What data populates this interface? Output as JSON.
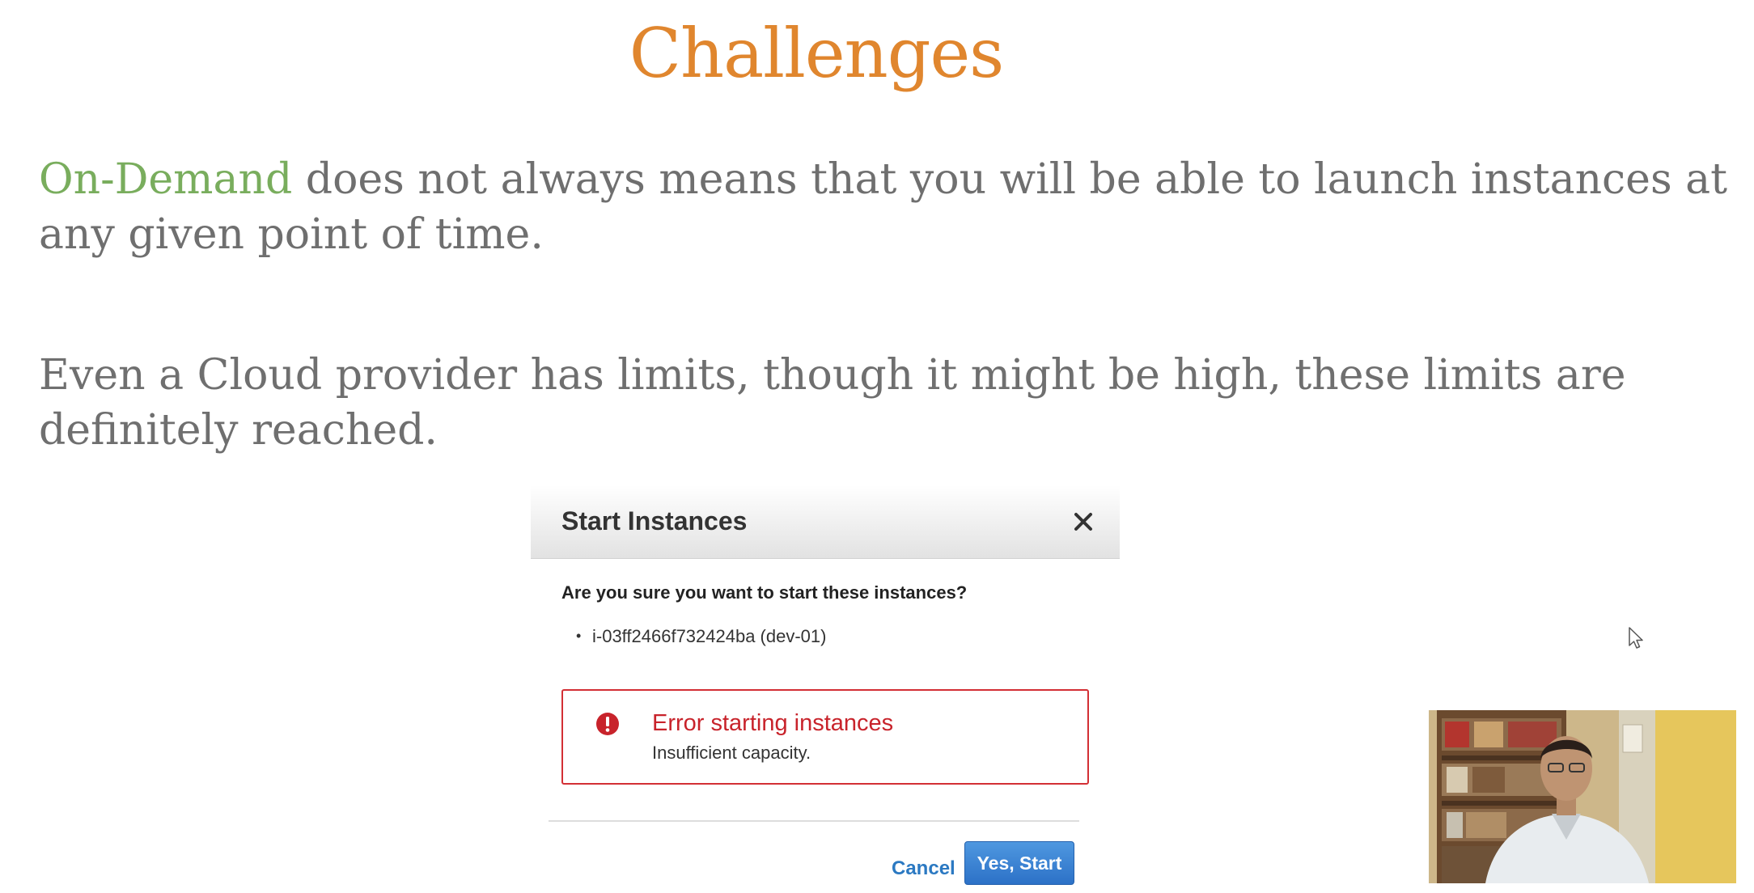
{
  "slide": {
    "title": "Challenges",
    "paragraph_1": {
      "highlight": "On-Demand",
      "text": " does not always means that you will be able to launch instances at any given point of time."
    },
    "paragraph_2": "Even a Cloud provider has limits, though it might be high, these limits are definitely reached."
  },
  "dialog": {
    "title": "Start Instances",
    "question": "Are you sure you want to start these instances?",
    "instances": [
      "i-03ff2466f732424ba (dev-01)"
    ],
    "error": {
      "title": "Error starting instances",
      "message": "Insufficient capacity."
    },
    "cancel_label": "Cancel",
    "confirm_label": "Yes, Start"
  },
  "colors": {
    "title": "#e0862e",
    "highlight": "#79ad5d",
    "body_text": "#6f6f6f",
    "error": "#d32f35",
    "primary": "#2c71c7",
    "link": "#2b79c2"
  },
  "icons": {
    "close": "close-icon",
    "error": "error-icon",
    "cursor": "mouse-cursor-icon"
  }
}
